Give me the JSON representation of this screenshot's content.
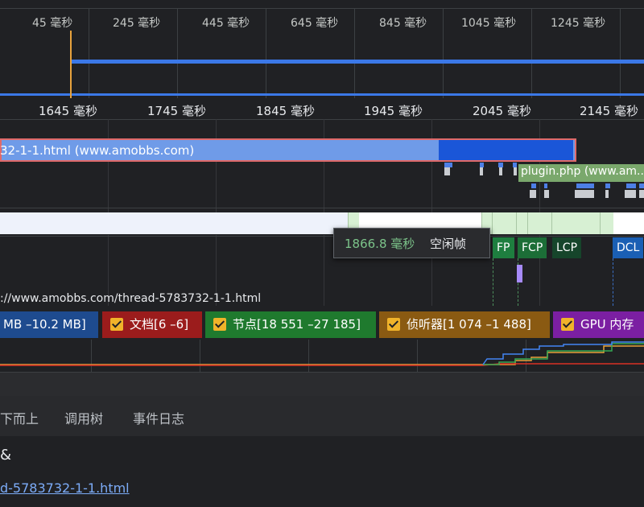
{
  "overview": {
    "ticks": [
      "45 毫秒",
      "245 毫秒",
      "445 毫秒",
      "645 毫秒",
      "845 毫秒",
      "1045 毫秒",
      "1245 毫秒"
    ]
  },
  "ruler": {
    "ticks": [
      "1645 毫秒",
      "1745 毫秒",
      "1845 毫秒",
      "1945 毫秒",
      "2045 毫秒",
      "2145 毫秒"
    ]
  },
  "flame": {
    "main_label": "32-1-1.html (www.amobbs.com)",
    "plugin_label": "plugin.php (www.am..."
  },
  "tooltip": {
    "value": "1866.8 毫秒",
    "label": "空闲帧"
  },
  "markers": {
    "fp": "FP",
    "fcp": "FCP",
    "lcp": "LCP",
    "dcl": "DCL"
  },
  "network_url": "://www.amobbs.com/thread-5783732-1-1.html",
  "legend": {
    "js_heap": "MB –10.2 MB]",
    "documents": "文档[6 –6]",
    "nodes": "节点[18 551 –27 185]",
    "listeners": "侦听器[1 074 –1 488]",
    "gpu": "GPU 内存"
  },
  "colors": {
    "js_heap": "#1e4b8f",
    "documents": "#9b1c1c",
    "nodes": "#1f7a2e",
    "listeners": "#8a5a12",
    "gpu": "#7b1fa2"
  },
  "bottom_tabs": [
    "下而上",
    "调用树",
    "事件日志"
  ],
  "details": {
    "summary_label": "& ",
    "link": "d-5783732-1-1.html"
  }
}
